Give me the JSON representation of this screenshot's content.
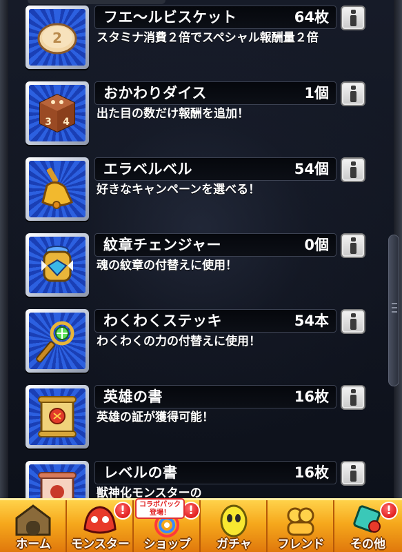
{
  "items": [
    {
      "name": "フエ～ルビスケット",
      "count": "64枚",
      "description": "スタミナ消費２倍でスペシャル報酬量２倍",
      "icon": "biscuit-icon"
    },
    {
      "name": "おかわりダイス",
      "count": "1個",
      "description": "出た目の数だけ報酬を追加！",
      "icon": "dice-icon"
    },
    {
      "name": "エラベルベル",
      "count": "54個",
      "description": "好きなキャンペーンを選べる！",
      "icon": "bell-icon"
    },
    {
      "name": "紋章チェンジャー",
      "count": "0個",
      "description": "魂の紋章の付替えに使用！",
      "icon": "emblem-changer-icon"
    },
    {
      "name": "わくわくステッキ",
      "count": "54本",
      "description": "わくわくの力の付替えに使用！",
      "icon": "magic-wand-icon"
    },
    {
      "name": "英雄の書",
      "count": "16枚",
      "description": "英雄の証が獲得可能！",
      "icon": "hero-scroll-icon"
    },
    {
      "name": "レベルの書",
      "count": "16枚",
      "description": "獣神化モンスターの",
      "icon": "level-scroll-icon"
    }
  ],
  "bottom_nav": {
    "home": "ホーム",
    "monster": "モンスター",
    "shop": "ショップ",
    "gacha": "ガチャ",
    "friend": "フレンド",
    "other": "その他",
    "promo_line1": "コラボパック",
    "promo_line2": "登場！",
    "alert": "!"
  },
  "colors": {
    "icon_bg": "#1e48c8",
    "nav_gradient_top": "#ffd24a",
    "nav_gradient_bottom": "#e0780c",
    "alert": "#d40000"
  }
}
